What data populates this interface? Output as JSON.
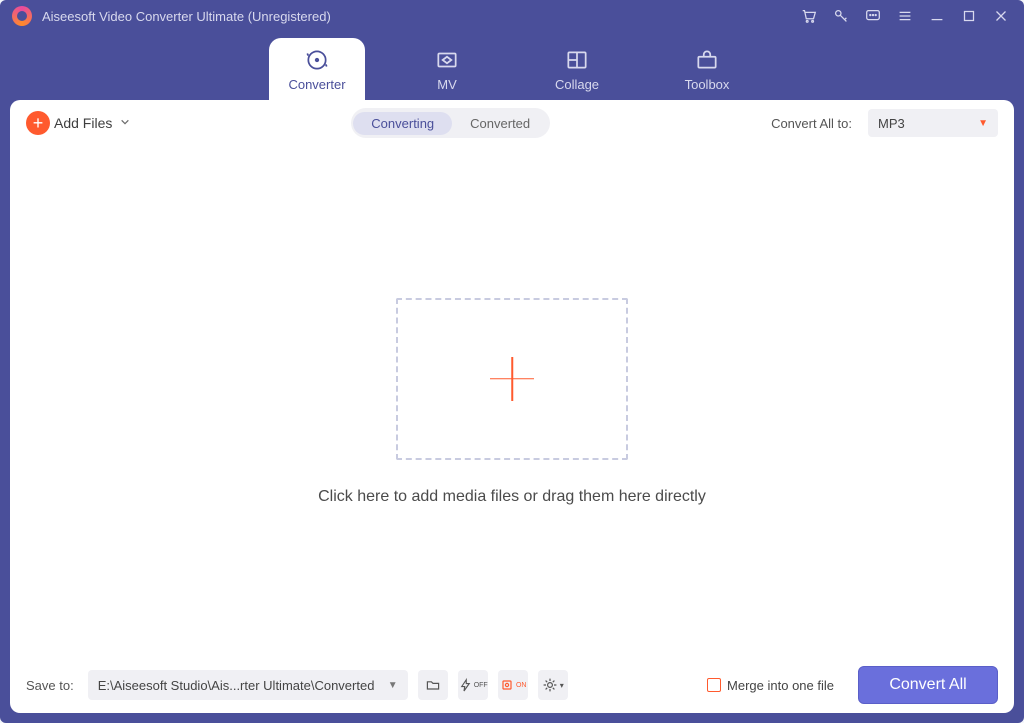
{
  "titlebar": {
    "title": "Aiseesoft Video Converter Ultimate (Unregistered)"
  },
  "nav": {
    "tabs": [
      {
        "label": "Converter"
      },
      {
        "label": "MV"
      },
      {
        "label": "Collage"
      },
      {
        "label": "Toolbox"
      }
    ]
  },
  "toolbar": {
    "add_files_label": "Add Files",
    "segments": {
      "converting": "Converting",
      "converted": "Converted"
    },
    "convert_all_to_label": "Convert All to:",
    "format_selected": "MP3"
  },
  "stage": {
    "hint": "Click here to add media files or drag them here directly"
  },
  "bottom": {
    "save_to_label": "Save to:",
    "path_value": "E:\\Aiseesoft Studio\\Ais...rter Ultimate\\Converted",
    "merge_label": "Merge into one file",
    "convert_all_button": "Convert All"
  }
}
